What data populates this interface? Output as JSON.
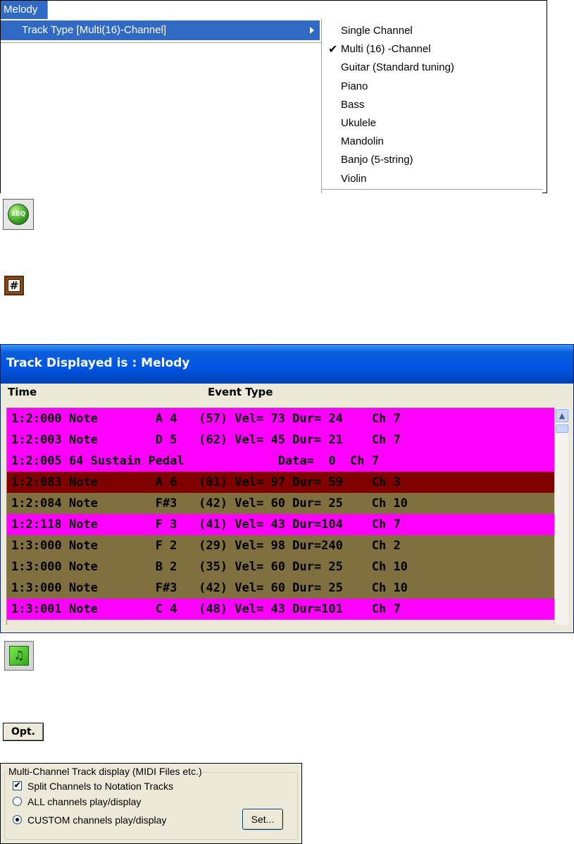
{
  "menu": {
    "title": "Melody",
    "item": {
      "label": "Track Type [Multi(16)-Channel]"
    },
    "submenu": [
      {
        "label": "Single Channel",
        "checked": false
      },
      {
        "label": "Multi (16) -Channel",
        "checked": true
      },
      {
        "label": "Guitar (Standard tuning)",
        "checked": false
      },
      {
        "label": "Piano",
        "checked": false
      },
      {
        "label": "Bass",
        "checked": false
      },
      {
        "label": "Ukulele",
        "checked": false
      },
      {
        "label": "Mandolin",
        "checked": false
      },
      {
        "label": "Banjo (5-string)",
        "checked": false
      },
      {
        "label": "Violin",
        "checked": false
      }
    ],
    "check_glyph": "✔"
  },
  "icons": {
    "seq": {
      "label": "SEQ",
      "name": "seq-icon"
    },
    "hash": {
      "label": "#",
      "name": "hash-icon"
    },
    "notation": {
      "glyph": "♫",
      "name": "notation-icon"
    }
  },
  "event_window": {
    "title": "Track Displayed is : Melody",
    "columns": [
      "Time",
      "Event Type"
    ],
    "rows": [
      {
        "text": "1:2:000 Note        A 4   (57) Vel= 73 Dur= 24    Ch 7",
        "color": "#ff00ff"
      },
      {
        "text": "1:2:003 Note        D 5   (62) Vel= 45 Dur= 21    Ch 7",
        "color": "#ff00ff"
      },
      {
        "text": "1:2:005 64 Sustain Pedal             Data=  0  Ch 7",
        "color": "#ff00ff"
      },
      {
        "text": "1:2:083 Note        A 6   (81) Vel= 97 Dur= 59    Ch 3",
        "color": "#800000"
      },
      {
        "text": "1:2:084 Note        F#3   (42) Vel= 60 Dur= 25    Ch 10",
        "color": "#807040"
      },
      {
        "text": "1:2:118 Note        F 3   (41) Vel= 43 Dur=104    Ch 7",
        "color": "#ff00ff"
      },
      {
        "text": "1:3:000 Note        F 2   (29) Vel= 98 Dur=240    Ch 2",
        "color": "#807040"
      },
      {
        "text": "1:3:000 Note        B 2   (35) Vel= 60 Dur= 25    Ch 10",
        "color": "#807040"
      },
      {
        "text": "1:3:000 Note        F#3   (42) Vel= 60 Dur= 25    Ch 10",
        "color": "#807040"
      },
      {
        "text": "1:3:001 Note        C 4   (48) Vel= 43 Dur=101    Ch 7",
        "color": "#ff00ff"
      }
    ]
  },
  "opt_button": {
    "label": "Opt."
  },
  "options": {
    "group_title": "Multi-Channel Track display (MIDI Files etc.)",
    "split_channels": {
      "label": "Split Channels to Notation Tracks",
      "checked": true
    },
    "all_channels": {
      "label": "ALL channels play/display",
      "selected": false
    },
    "custom_channels": {
      "label": "CUSTOM channels play/display",
      "selected": true
    },
    "set_button": {
      "label": "Set..."
    }
  },
  "colors": {
    "menu_highlight": "#316ac5",
    "titlebar": "#0054e3",
    "row_magenta": "#ff00ff",
    "row_olive": "#807040",
    "row_maroon": "#800000"
  }
}
